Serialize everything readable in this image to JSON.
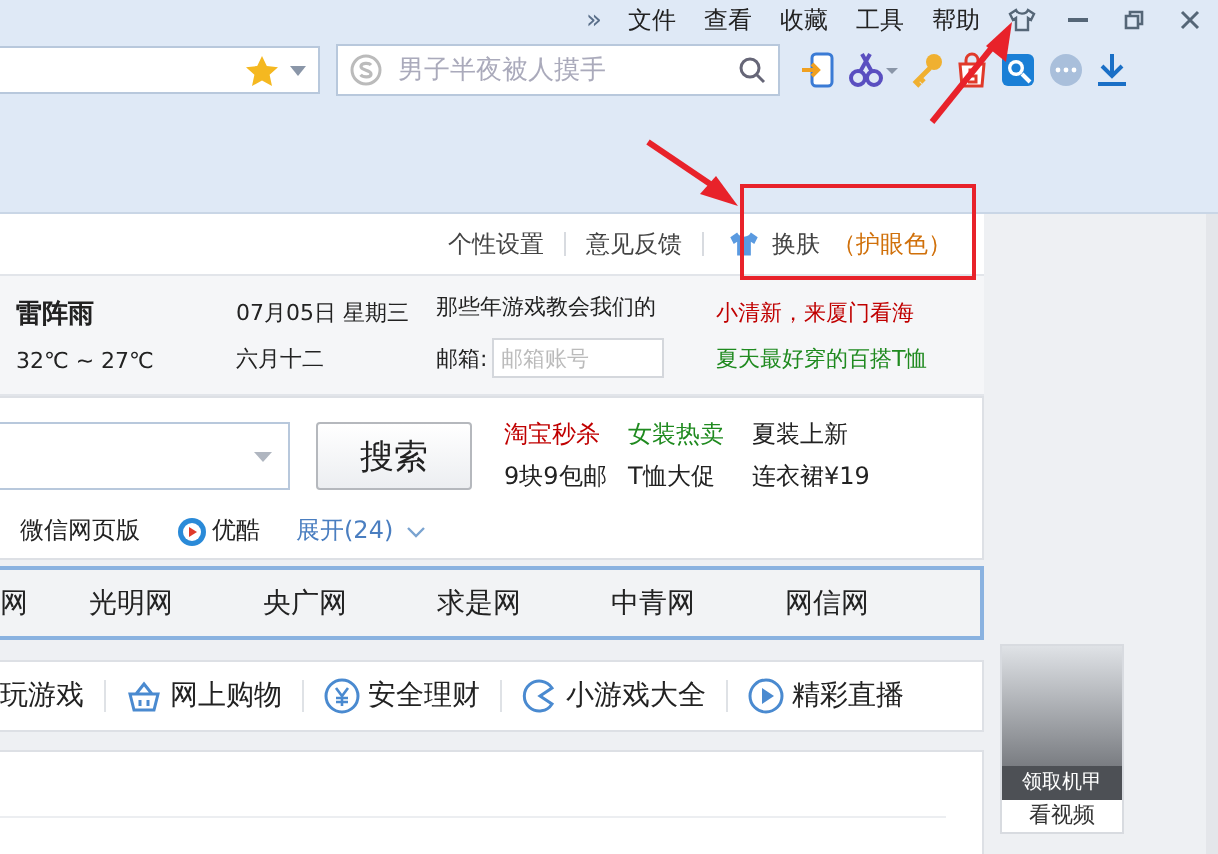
{
  "menu": {
    "more": "»",
    "items": [
      "文件",
      "查看",
      "收藏",
      "工具",
      "帮助"
    ]
  },
  "search": {
    "placeholder": "男子半夜被人摸手"
  },
  "top_links": [
    "个性设置",
    "意见反馈"
  ],
  "skin": {
    "label": "换肤",
    "mode": "（护眼色）"
  },
  "weather": {
    "condition": "雷阵雨",
    "temperature": "32℃ ~ 27℃"
  },
  "date": {
    "solar": "07月05日 星期三",
    "lunar": "六月十二"
  },
  "mail": {
    "headline": "那些年游戏教会我们的",
    "label": "邮箱:",
    "placeholder": "邮箱账号"
  },
  "promos": [
    {
      "text": "小清新，来厦门看海",
      "color": "#c00000"
    },
    {
      "text": "夏天最好穿的百搭T恤",
      "color": "#1f8a1f"
    }
  ],
  "search_button": "搜索",
  "deals": [
    {
      "text": "淘宝秒杀",
      "color": "#c00000"
    },
    {
      "text": "女装热卖",
      "color": "#1f8a1f"
    },
    {
      "text": "夏装上新",
      "color": "#222222"
    },
    {
      "text": "9块9包邮",
      "color": "#222222"
    },
    {
      "text": "T恤大促",
      "color": "#222222"
    },
    {
      "text": "连衣裙¥19",
      "color": "#222222"
    }
  ],
  "quick_links": [
    {
      "kind": "text",
      "label": "微信网页版"
    },
    {
      "kind": "video",
      "label": "优酷"
    },
    {
      "kind": "expand",
      "label": "展开(24)"
    }
  ],
  "sites": [
    "网",
    "光明网",
    "央广网",
    "求是网",
    "中青网",
    "网信网"
  ],
  "nav": [
    {
      "kind": "plain",
      "label": "玩游戏"
    },
    {
      "kind": "basket",
      "label": "网上购物"
    },
    {
      "kind": "yuan",
      "label": "安全理财"
    },
    {
      "kind": "pacman",
      "label": "小游戏大全"
    },
    {
      "kind": "play",
      "label": "精彩直播"
    }
  ],
  "ad": {
    "caption": "领取机甲",
    "link": "看视频"
  }
}
